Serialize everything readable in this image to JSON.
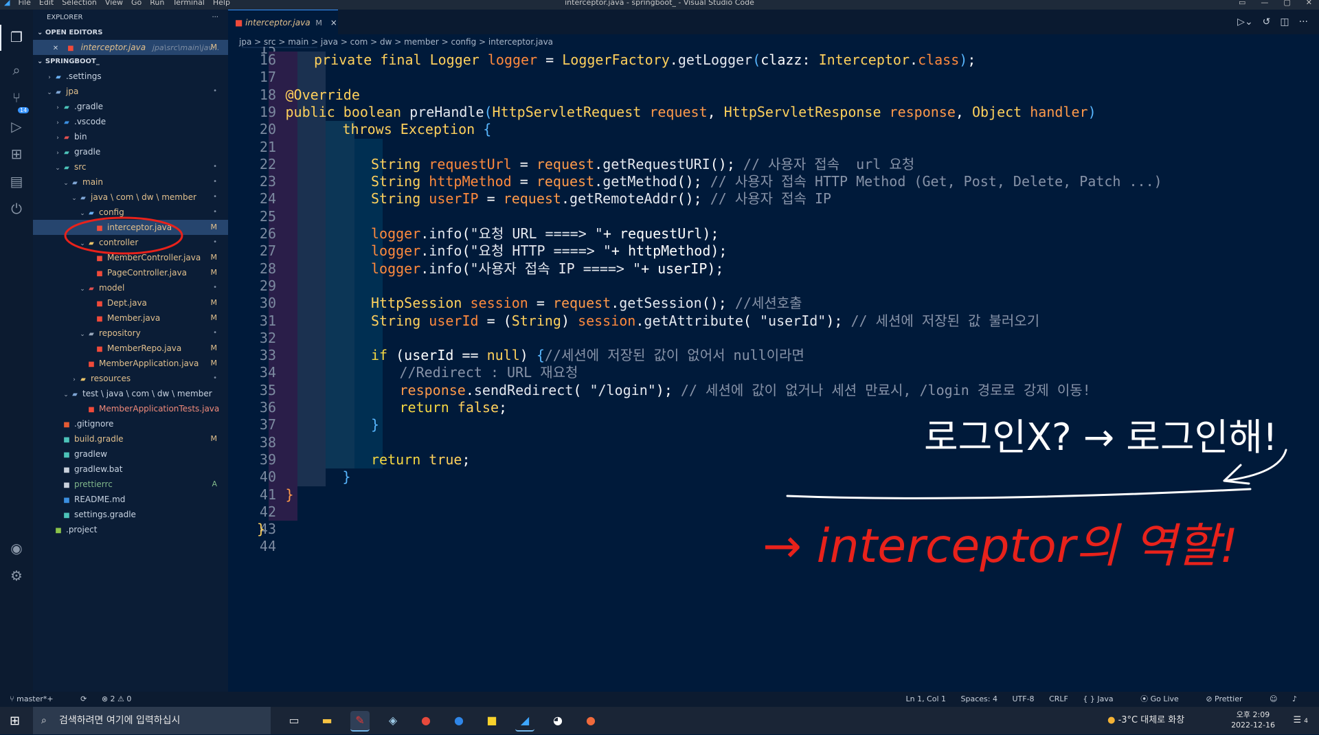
{
  "window": {
    "menus": [
      "File",
      "Edit",
      "Selection",
      "View",
      "Go",
      "Run",
      "Terminal",
      "Help"
    ],
    "title": "interceptor.java - springboot_ - Visual Studio Code"
  },
  "activity_bar": {
    "scm_badge": "14"
  },
  "explorer": {
    "header": "EXPLORER",
    "more": "···",
    "open_editors_label": "OPEN EDITORS",
    "open_editor": {
      "name": "interceptor.java",
      "path": "jpa\\src\\main\\jav...",
      "status": "M"
    },
    "workspace_label": "SPRINGBOOT_",
    "tree": [
      {
        "depth": 1,
        "chevron": "›",
        "icon": "settings-folder-icon",
        "label": ".settings",
        "status": ""
      },
      {
        "depth": 1,
        "chevron": "⌄",
        "icon": "folder-icon",
        "label": "jpa",
        "status": "•",
        "mod": true
      },
      {
        "depth": 2,
        "chevron": "›",
        "icon": "gradle-folder-icon",
        "label": ".gradle",
        "status": ""
      },
      {
        "depth": 2,
        "chevron": "›",
        "icon": "vscode-folder-icon",
        "label": ".vscode",
        "status": ""
      },
      {
        "depth": 2,
        "chevron": "›",
        "icon": "bin-folder-icon",
        "label": "bin",
        "status": ""
      },
      {
        "depth": 2,
        "chevron": "›",
        "icon": "gradle-folder-icon",
        "label": "gradle",
        "status": ""
      },
      {
        "depth": 2,
        "chevron": "⌄",
        "icon": "src-folder-icon",
        "label": "src",
        "status": "•",
        "mod": true
      },
      {
        "depth": 3,
        "chevron": "⌄",
        "icon": "folder-icon",
        "label": "main",
        "status": "•",
        "mod": true
      },
      {
        "depth": 4,
        "chevron": "⌄",
        "icon": "folder-icon",
        "label": "java \\ com \\ dw \\ member",
        "status": "•",
        "mod": true
      },
      {
        "depth": 5,
        "chevron": "⌄",
        "icon": "config-folder-icon",
        "label": "config",
        "status": "•",
        "mod": true
      },
      {
        "depth": 6,
        "chevron": "",
        "icon": "java-file-icon",
        "label": "interceptor.java",
        "status": "M",
        "mod": true,
        "selected": true
      },
      {
        "depth": 5,
        "chevron": "⌄",
        "icon": "controller-folder-icon",
        "label": "controller",
        "status": "•",
        "mod": true
      },
      {
        "depth": 6,
        "chevron": "",
        "icon": "java-file-icon",
        "label": "MemberController.java",
        "status": "M",
        "mod": true
      },
      {
        "depth": 6,
        "chevron": "",
        "icon": "java-file-icon",
        "label": "PageController.java",
        "status": "M",
        "mod": true
      },
      {
        "depth": 5,
        "chevron": "⌄",
        "icon": "model-folder-icon",
        "label": "model",
        "status": "•",
        "mod": true
      },
      {
        "depth": 6,
        "chevron": "",
        "icon": "java-file-icon",
        "label": "Dept.java",
        "status": "M",
        "mod": true
      },
      {
        "depth": 6,
        "chevron": "",
        "icon": "java-file-icon",
        "label": "Member.java",
        "status": "M",
        "mod": true
      },
      {
        "depth": 5,
        "chevron": "⌄",
        "icon": "repository-folder-icon",
        "label": "repository",
        "status": "•",
        "mod": true
      },
      {
        "depth": 6,
        "chevron": "",
        "icon": "java-file-icon",
        "label": "MemberRepo.java",
        "status": "M",
        "mod": true
      },
      {
        "depth": 5,
        "chevron": "",
        "icon": "java-file-icon",
        "label": "MemberApplication.java",
        "status": "M",
        "mod": true
      },
      {
        "depth": 4,
        "chevron": "›",
        "icon": "resources-folder-icon",
        "label": "resources",
        "status": "•",
        "mod": true
      },
      {
        "depth": 3,
        "chevron": "⌄",
        "icon": "folder-icon",
        "label": "test \\ java \\ com \\ dw \\ member",
        "status": ""
      },
      {
        "depth": 5,
        "chevron": "",
        "icon": "java-file-icon",
        "label": "MemberApplicationTests.java",
        "status": "",
        "java": true
      },
      {
        "depth": 2,
        "chevron": "",
        "icon": "git-file-icon",
        "label": ".gitignore",
        "status": ""
      },
      {
        "depth": 2,
        "chevron": "",
        "icon": "gradle-file-icon",
        "label": "build.gradle",
        "status": "M",
        "mod": true
      },
      {
        "depth": 2,
        "chevron": "",
        "icon": "gradle-file-icon",
        "label": "gradlew",
        "status": ""
      },
      {
        "depth": 2,
        "chevron": "",
        "icon": "terminal-file-icon",
        "label": "gradlew.bat",
        "status": ""
      },
      {
        "depth": 2,
        "chevron": "",
        "icon": "prettier-file-icon",
        "label": "prettierrc",
        "status": "A",
        "added": true
      },
      {
        "depth": 2,
        "chevron": "",
        "icon": "info-file-icon",
        "label": "README.md",
        "status": ""
      },
      {
        "depth": 2,
        "chevron": "",
        "icon": "gradle-file-icon",
        "label": "settings.gradle",
        "status": ""
      },
      {
        "depth": 1,
        "chevron": "",
        "icon": "project-file-icon",
        "label": ".project",
        "status": ""
      }
    ]
  },
  "tab": {
    "label": "interceptor.java",
    "status": "M",
    "close": "×"
  },
  "breadcrumb": "jpa > src > main > java > com > dw > member > config > interceptor.java",
  "code_lines": [
    {
      "n": "16",
      "ind": 2,
      "toks": [
        [
          "kw",
          "private "
        ],
        [
          "kw",
          "final "
        ],
        [
          "t",
          "Logger "
        ],
        [
          "v",
          "logger"
        ],
        [
          "p",
          " = "
        ],
        [
          "t",
          "LoggerFactory"
        ],
        [
          "p",
          "."
        ],
        [
          "f",
          "getLogger"
        ],
        [
          "br",
          "("
        ],
        [
          "p",
          "clazz: "
        ],
        [
          "t",
          "Interceptor"
        ],
        [
          "p",
          "."
        ],
        [
          "v",
          "class"
        ],
        [
          "br",
          ")"
        ],
        [
          "p",
          ";"
        ]
      ]
    },
    {
      "n": "17",
      "ind": 0,
      "toks": []
    },
    {
      "n": "18",
      "ind": 1,
      "toks": [
        [
          "an",
          "@Override"
        ]
      ]
    },
    {
      "n": "19",
      "ind": 1,
      "toks": [
        [
          "kw",
          "public "
        ],
        [
          "kw",
          "boolean "
        ],
        [
          "f",
          "preHandle"
        ],
        [
          "br",
          "("
        ],
        [
          "t",
          "HttpServletRequest "
        ],
        [
          "pm",
          "request"
        ],
        [
          "p",
          ", "
        ],
        [
          "t",
          "HttpServletResponse "
        ],
        [
          "pm",
          "response"
        ],
        [
          "p",
          ", "
        ],
        [
          "t",
          "Object "
        ],
        [
          "pm",
          "handler"
        ],
        [
          "br",
          ")"
        ]
      ]
    },
    {
      "n": "20",
      "ind": 3,
      "toks": [
        [
          "kw",
          "throws "
        ],
        [
          "t",
          "Exception "
        ],
        [
          "br",
          "{"
        ]
      ]
    },
    {
      "n": "21",
      "ind": 0,
      "toks": []
    },
    {
      "n": "22",
      "ind": 4,
      "toks": [
        [
          "t",
          "String "
        ],
        [
          "v",
          "requestUrl"
        ],
        [
          "p",
          " = "
        ],
        [
          "pm",
          "request"
        ],
        [
          "p",
          "."
        ],
        [
          "f",
          "getRequestURI"
        ],
        [
          "p",
          "(); "
        ],
        [
          "c",
          "// 사용자 접속  url 요청"
        ]
      ]
    },
    {
      "n": "23",
      "ind": 4,
      "toks": [
        [
          "t",
          "String "
        ],
        [
          "v",
          "httpMethod"
        ],
        [
          "p",
          " = "
        ],
        [
          "pm",
          "request"
        ],
        [
          "p",
          "."
        ],
        [
          "f",
          "getMethod"
        ],
        [
          "p",
          "(); "
        ],
        [
          "c",
          "// 사용자 접속 HTTP Method (Get, Post, Delete, Patch ...)"
        ]
      ]
    },
    {
      "n": "24",
      "ind": 4,
      "toks": [
        [
          "t",
          "String "
        ],
        [
          "v",
          "userIP"
        ],
        [
          "p",
          " = "
        ],
        [
          "pm",
          "request"
        ],
        [
          "p",
          "."
        ],
        [
          "f",
          "getRemoteAddr"
        ],
        [
          "p",
          "(); "
        ],
        [
          "c",
          "// 사용자 접속 IP"
        ]
      ]
    },
    {
      "n": "25",
      "ind": 0,
      "toks": []
    },
    {
      "n": "26",
      "ind": 4,
      "toks": [
        [
          "v",
          "logger"
        ],
        [
          "p",
          "."
        ],
        [
          "f",
          "info"
        ],
        [
          "p",
          "("
        ],
        [
          "s",
          "\"요청 URL ====> \""
        ],
        [
          "p",
          "+ requestUrl);"
        ]
      ]
    },
    {
      "n": "27",
      "ind": 4,
      "toks": [
        [
          "v",
          "logger"
        ],
        [
          "p",
          "."
        ],
        [
          "f",
          "info"
        ],
        [
          "p",
          "("
        ],
        [
          "s",
          "\"요청 HTTP ====> \""
        ],
        [
          "p",
          "+ httpMethod);"
        ]
      ]
    },
    {
      "n": "28",
      "ind": 4,
      "toks": [
        [
          "v",
          "logger"
        ],
        [
          "p",
          "."
        ],
        [
          "f",
          "info"
        ],
        [
          "p",
          "("
        ],
        [
          "s",
          "\"사용자 접속 IP ====> \""
        ],
        [
          "p",
          "+ userIP);"
        ]
      ]
    },
    {
      "n": "29",
      "ind": 0,
      "toks": []
    },
    {
      "n": "30",
      "ind": 4,
      "toks": [
        [
          "t",
          "HttpSession "
        ],
        [
          "v",
          "session"
        ],
        [
          "p",
          " = "
        ],
        [
          "pm",
          "request"
        ],
        [
          "p",
          "."
        ],
        [
          "f",
          "getSession"
        ],
        [
          "p",
          "(); "
        ],
        [
          "c",
          "//세션호출"
        ]
      ]
    },
    {
      "n": "31",
      "ind": 4,
      "toks": [
        [
          "t",
          "String "
        ],
        [
          "v",
          "userId"
        ],
        [
          "p",
          " = ("
        ],
        [
          "t",
          "String"
        ],
        [
          "p",
          ") "
        ],
        [
          "v",
          "session"
        ],
        [
          "p",
          "."
        ],
        [
          "f",
          "getAttribute"
        ],
        [
          "p",
          "( "
        ],
        [
          "s",
          "\"userId\""
        ],
        [
          "p",
          "); "
        ],
        [
          "c",
          "// 세션에 저장된 값 불러오기"
        ]
      ]
    },
    {
      "n": "32",
      "ind": 0,
      "toks": []
    },
    {
      "n": "33",
      "ind": 4,
      "toks": [
        [
          "k",
          "if "
        ],
        [
          "p",
          "(userId == "
        ],
        [
          "kw",
          "null"
        ],
        [
          "p",
          ") "
        ],
        [
          "br",
          "{"
        ],
        [
          "c",
          "//세션에 저장된 값이 없어서 null이라면"
        ]
      ]
    },
    {
      "n": "34",
      "ind": 5,
      "toks": [
        [
          "c",
          "//Redirect : URL 재요청"
        ]
      ]
    },
    {
      "n": "35",
      "ind": 5,
      "toks": [
        [
          "pm",
          "response"
        ],
        [
          "p",
          "."
        ],
        [
          "f",
          "sendRedirect"
        ],
        [
          "p",
          "( "
        ],
        [
          "s",
          "\"/login\""
        ],
        [
          "p",
          "); "
        ],
        [
          "c",
          "// 세션에 값이 없거나 세션 만료시, /login 경로로 강제 이동!"
        ]
      ]
    },
    {
      "n": "36",
      "ind": 5,
      "toks": [
        [
          "k",
          "return "
        ],
        [
          "kw",
          "false"
        ],
        [
          "p",
          ";"
        ]
      ]
    },
    {
      "n": "37",
      "ind": 4,
      "toks": [
        [
          "br",
          "}"
        ]
      ]
    },
    {
      "n": "38",
      "ind": 0,
      "toks": []
    },
    {
      "n": "39",
      "ind": 4,
      "toks": [
        [
          "k",
          "return "
        ],
        [
          "kw",
          "true"
        ],
        [
          "p",
          ";"
        ]
      ]
    },
    {
      "n": "40",
      "ind": 3,
      "toks": [
        [
          "br",
          "}"
        ]
      ]
    },
    {
      "n": "41",
      "ind": 1,
      "toks": [
        [
          "pm",
          "}"
        ]
      ]
    },
    {
      "n": "42",
      "ind": 0,
      "toks": []
    },
    {
      "n": "43",
      "ind": 0,
      "toks": [
        [
          "kw",
          "}"
        ]
      ]
    },
    {
      "n": "44",
      "ind": 0,
      "toks": []
    }
  ],
  "first_partial_line": "15",
  "annotations": {
    "login_note": "로그인X? → 로그인해!",
    "role_note": "→ interceptor의 역할!",
    "color": "#e8221b"
  },
  "status_bar": {
    "branch": "master*+",
    "problems": "⊗ 2 ⚠ 0",
    "position": "Ln 1, Col 1",
    "spaces": "Spaces: 4",
    "encoding": "UTF-8",
    "eol": "CRLF",
    "language": "Java",
    "golive": "Go Live",
    "prettier": "Prettier"
  },
  "taskbar": {
    "search_placeholder": "검색하려면 여기에 입력하십시",
    "weather": "-3°C  대체로 화창",
    "time": "오후 2:09",
    "date": "2022-12-16",
    "notifications": "4"
  },
  "colors": {
    "accent": "#3794ff",
    "editor_bg": "#001a3a",
    "modified": "#e2c08d"
  }
}
